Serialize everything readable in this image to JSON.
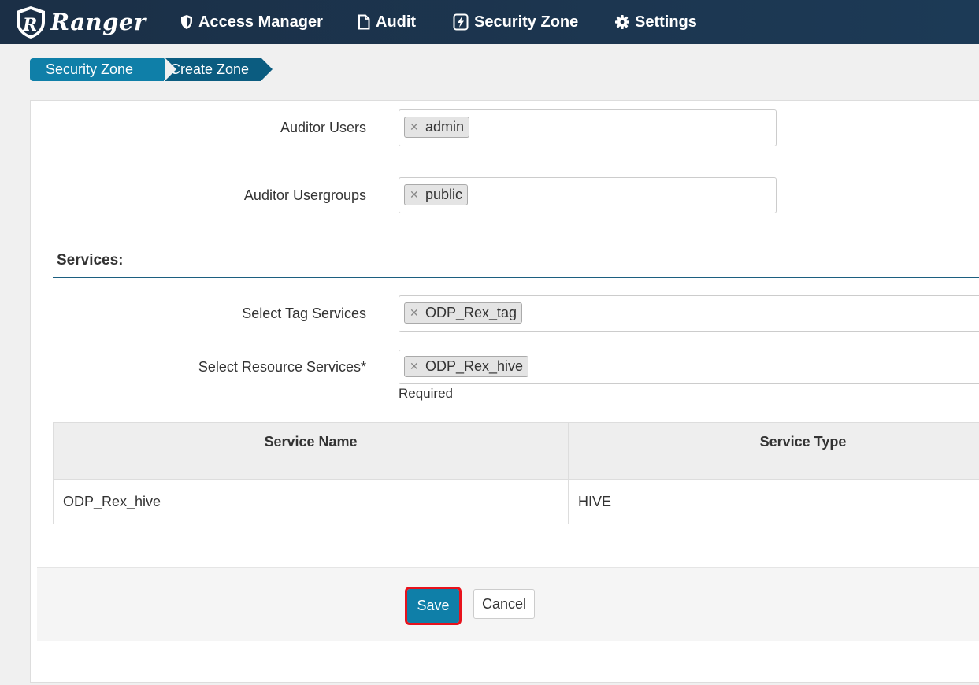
{
  "app": {
    "brand_name": "Ranger",
    "nav": [
      {
        "label": "Access Manager",
        "icon": "shield-icon"
      },
      {
        "label": "Audit",
        "icon": "file-icon"
      },
      {
        "label": "Security Zone",
        "icon": "bolt-icon"
      },
      {
        "label": "Settings",
        "icon": "gear-icon"
      }
    ]
  },
  "breadcrumb": [
    {
      "label": "Security Zone"
    },
    {
      "label": "Create Zone"
    }
  ],
  "form": {
    "auditor_users": {
      "label": "Auditor Users",
      "tags": [
        "admin"
      ]
    },
    "auditor_usergroups": {
      "label": "Auditor Usergroups",
      "tags": [
        "public"
      ]
    },
    "services_heading": "Services:",
    "tag_services": {
      "label": "Select Tag Services",
      "tags": [
        "ODP_Rex_tag"
      ]
    },
    "resource_services": {
      "label": "Select Resource Services*",
      "tags": [
        "ODP_Rex_hive"
      ],
      "help": "Required"
    }
  },
  "services_table": {
    "headers": [
      "Service Name",
      "Service Type"
    ],
    "rows": [
      {
        "name": "ODP_Rex_hive",
        "type": "HIVE"
      }
    ]
  },
  "actions": {
    "save_label": "Save",
    "cancel_label": "Cancel"
  },
  "colors": {
    "navbar": "#1b2f46",
    "primary": "#0f7fa8",
    "highlight": "#e8121c"
  }
}
